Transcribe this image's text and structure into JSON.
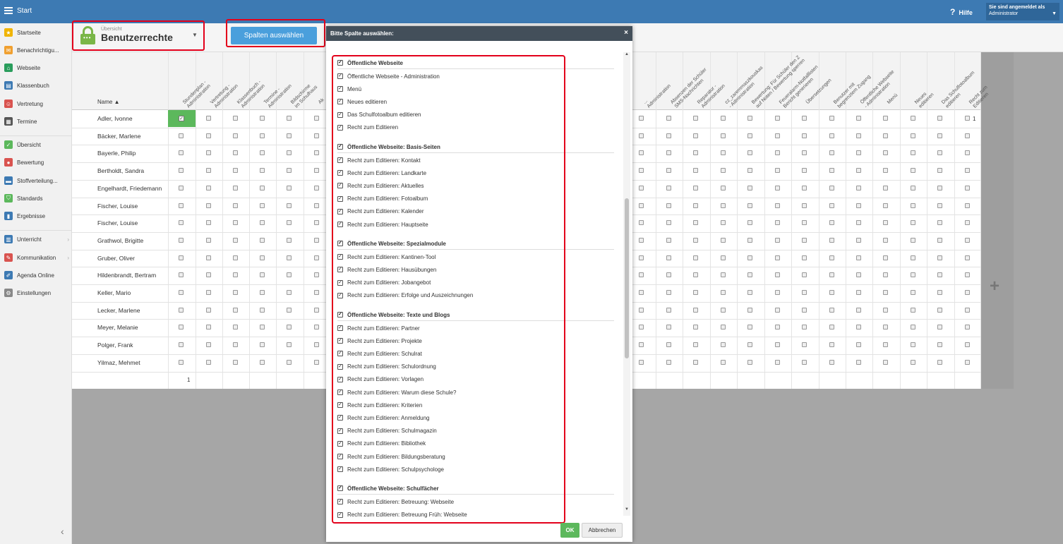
{
  "topbar": {
    "title": "Start",
    "help": "Hilfe",
    "user_line1": "Sie sind angemeldet als",
    "user_line2": "Administrator"
  },
  "sidebar": {
    "items": [
      {
        "label": "Startseite",
        "icon": "star-icon",
        "color": "#f0b400"
      },
      {
        "label": "Benachrichtigu...",
        "icon": "mail-icon",
        "color": "#f0a030"
      },
      {
        "label": "Webseite",
        "icon": "home-icon",
        "color": "#2a9d5c"
      },
      {
        "label": "Klassenbuch",
        "icon": "book-icon",
        "color": "#3d7ab3"
      },
      {
        "label": "Vertretung",
        "icon": "person-icon",
        "color": "#d9534f"
      },
      {
        "label": "Termine",
        "icon": "calendar-icon",
        "color": "#555555"
      },
      {
        "label": "Übersicht",
        "icon": "check-icon",
        "color": "#5cb85c"
      },
      {
        "label": "Bewertung",
        "icon": "rating-icon",
        "color": "#d9534f"
      },
      {
        "label": "Stoffverteilung...",
        "icon": "briefcase-icon",
        "color": "#3d7ab3"
      },
      {
        "label": "Standards",
        "icon": "shield-icon",
        "color": "#5cb85c"
      },
      {
        "label": "Ergebnisse",
        "icon": "bar-chart-icon",
        "color": "#3d7ab3"
      },
      {
        "label": "Unterricht",
        "icon": "building-icon",
        "color": "#3d7ab3"
      },
      {
        "label": "Kommunikation",
        "icon": "chat-icon",
        "color": "#d9534f"
      },
      {
        "label": "Agenda Online",
        "icon": "pen-icon",
        "color": "#3d7ab3"
      },
      {
        "label": "Einstellungen",
        "icon": "gear-icon",
        "color": "#888888"
      }
    ]
  },
  "view": {
    "small": "Übersicht",
    "title": "Benutzerrechte"
  },
  "columns_button": "Spalten auswählen",
  "grid": {
    "name_header": "Name ▲",
    "columns_left": [
      "Stundenplan -\nAdministration",
      "Vertretung -\nAdministration",
      "Klassenbuch -\nAdministration",
      "Termine -\nAdministration",
      "Bildschirme\nim Schulhaus",
      "Ak"
    ],
    "columns_right": [
      "...\nAdministration",
      "Absenzen der Schüler\nSMS-Nachrichten",
      "Reparatur -\nAdministration",
      "cz_zaremmaszkouskas\n- Administration",
      "Bewertung: Für Schüler den Z\nauf Noten / Bewertung sperren",
      "Feueralarm-Notfalllisten\nBericht generieren",
      "Übersetzungen",
      "Benutzer mit\nbegrenztem Zugang",
      "Öffentliche Webseite\n- Administration",
      "Menü",
      "Neues\neditieren",
      "Das Schulfotoalbum\neditieren",
      "Recht zum\nEditieren"
    ],
    "rows": [
      "Adler, Ivonne",
      "Bäcker, Marlene",
      "Bayerle, Philip",
      "Bertholdt, Sandra",
      "Engelhardt, Friedemann",
      "Fischer, Louise",
      "Fischer, Louise",
      "Grathwol, Brigitte",
      "Gruber, Oliver",
      "Hildenbrandt, Bertram",
      "Keller, Mario",
      "Lecker, Marlene",
      "Meyer, Melanie",
      "Polger, Frank",
      "Yilmaz, Mehmet"
    ],
    "first_row_count": "1",
    "footer_count": "1"
  },
  "modal": {
    "title": "Bitte Spalte auswählen:",
    "close": "×",
    "check_mark": "✓",
    "groups": [
      {
        "title": "Öffentliche Webseite",
        "items": [
          "Öffentliche Webseite - Administration",
          "Menü",
          "Neues editieren",
          "Das Schulfotoalbum editieren",
          "Recht zum Editieren"
        ]
      },
      {
        "title": "Öffentliche Webseite: Basis-Seiten",
        "items": [
          "Recht zum Editieren: Kontakt",
          "Recht zum Editieren: Landkarte",
          "Recht zum Editieren: Aktuelles",
          "Recht zum Editieren: Fotoalbum",
          "Recht zum Editieren: Kalender",
          "Recht zum Editieren: Hauptseite"
        ]
      },
      {
        "title": "Öffentliche Webseite: Spezialmodule",
        "items": [
          "Recht zum Editieren: Kantinen-Tool",
          "Recht zum Editieren: Hausübungen",
          "Recht zum Editieren: Jobangebot",
          "Recht zum Editieren: Erfolge und Auszeichnungen"
        ]
      },
      {
        "title": "Öffentliche Webseite: Texte und Blogs",
        "items": [
          "Recht zum Editieren: Partner",
          "Recht zum Editieren: Projekte",
          "Recht zum Editieren: Schulrat",
          "Recht zum Editieren: Schulordnung",
          "Recht zum Editieren: Vorlagen",
          "Recht zum Editieren: Warum diese Schule?",
          "Recht zum Editieren: Kriterien",
          "Recht zum Editieren: Anmeldung",
          "Recht zum Editieren: Schulmagazin",
          "Recht zum Editieren: Bibliothek",
          "Recht zum Editieren: Bildungsberatung",
          "Recht zum Editieren: Schulpsychologe"
        ]
      },
      {
        "title": "Öffentliche Webseite: Schulfächer",
        "items": [
          "Recht zum Editieren: Betreuung: Webseite",
          "Recht zum Editieren: Betreuung Früh: Webseite"
        ]
      }
    ],
    "ok": "OK",
    "cancel": "Abbrechen"
  },
  "colors": {
    "topbar": "#3d7ab3",
    "accent_green": "#5cb85c",
    "highlight_red": "#e3001b",
    "button_blue": "#4a9fdc"
  }
}
